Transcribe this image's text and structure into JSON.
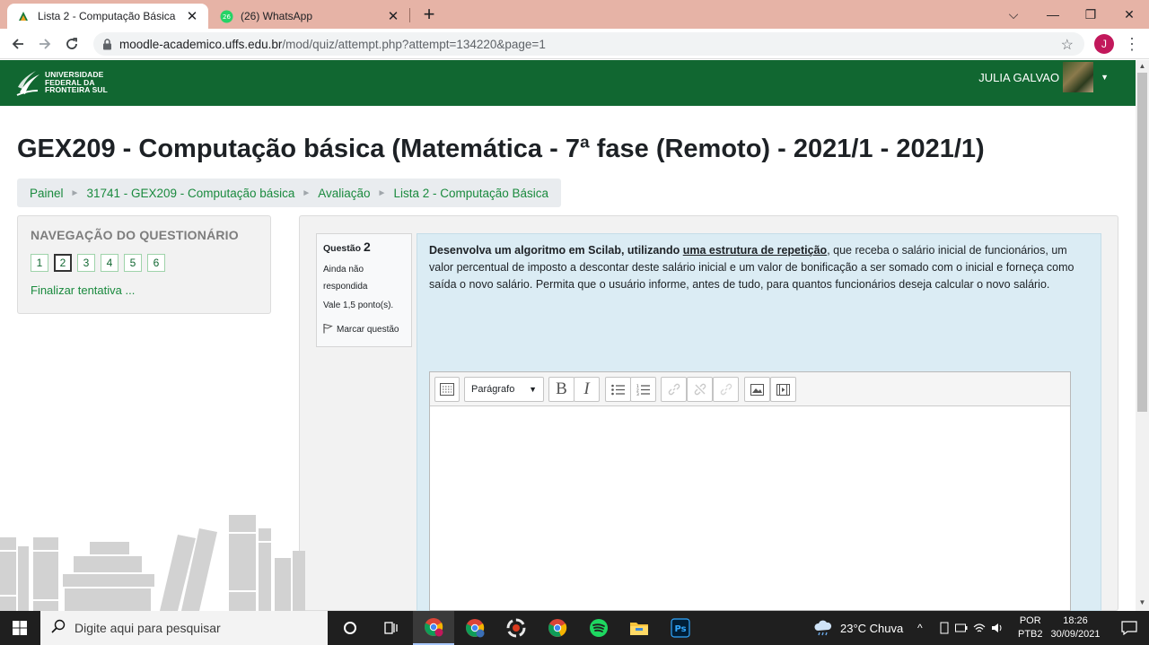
{
  "browser": {
    "tabs": [
      {
        "title": "Lista 2 - Computação Básica",
        "icon": "moodle-icon",
        "active": true
      },
      {
        "title": "(26) WhatsApp",
        "icon": "whatsapp-icon",
        "active": false
      }
    ],
    "tab_close": "✕",
    "new_tab": "+",
    "address": {
      "host": "moodle-academico.uffs.edu.br",
      "path": "/mod/quiz/attempt.php?attempt=134220&page=1"
    },
    "profile_initial": "J",
    "window_controls": {
      "chevron": "⌵",
      "minimize": "—",
      "restore": "❐",
      "close": "✕"
    }
  },
  "site": {
    "logo_lines": [
      "UNIVERSIDADE",
      "FEDERAL DA",
      "FRONTEIRA SUL"
    ],
    "user_name": "JULIA GALVAO"
  },
  "page": {
    "title": "GEX209 - Computação básica (Matemática - 7ª fase (Remoto) - 2021/1 - 2021/1)",
    "breadcrumb": [
      "Painel",
      "31741 - GEX209 - Computação básica",
      "Avaliação",
      "Lista 2 - Computação Básica"
    ]
  },
  "quiz_nav": {
    "heading": "NAVEGAÇÃO DO QUESTIONÁRIO",
    "questions": [
      "1",
      "2",
      "3",
      "4",
      "5",
      "6"
    ],
    "current": "2",
    "finish_label": "Finalizar tentativa ..."
  },
  "question": {
    "label": "Questão",
    "number": "2",
    "state_line1": "Ainda não",
    "state_line2": "respondida",
    "grade": "Vale 1,5 ponto(s).",
    "flag_label": "Marcar questão",
    "text_bold": "Desenvolva um algoritmo em Scilab, utilizando",
    "text_underlined": "uma estrutura de repetição",
    "text_rest": ", que receba o salário inicial de funcionários, um valor percentual de imposto a descontar deste salário inicial e um valor de bonificação a ser somado com o inicial e forneça como saída o novo salário. Permita que o usuário informe, antes de tudo, para quantos funcionários deseja calcular o novo salário."
  },
  "editor": {
    "paragraph_select": "Parágrafo",
    "bold": "B",
    "italic": "I"
  },
  "taskbar": {
    "search_placeholder": "Digite aqui para pesquisar",
    "weather": "23°C  Chuva",
    "lang_line1": "POR",
    "lang_line2": "PTB2",
    "time": "18:26",
    "date": "30/09/2021"
  }
}
